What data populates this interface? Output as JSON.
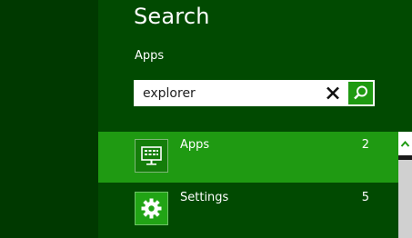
{
  "search": {
    "title": "Search",
    "scope_label": "Apps",
    "query": "explorer"
  },
  "results": [
    {
      "label": "Apps",
      "count": "2",
      "icon": "apps-icon",
      "selected": true
    },
    {
      "label": "Settings",
      "count": "5",
      "icon": "gear-icon",
      "selected": false
    }
  ],
  "colors": {
    "background": "#014a01",
    "left_background": "#003900",
    "accent": "#1f9a12"
  }
}
